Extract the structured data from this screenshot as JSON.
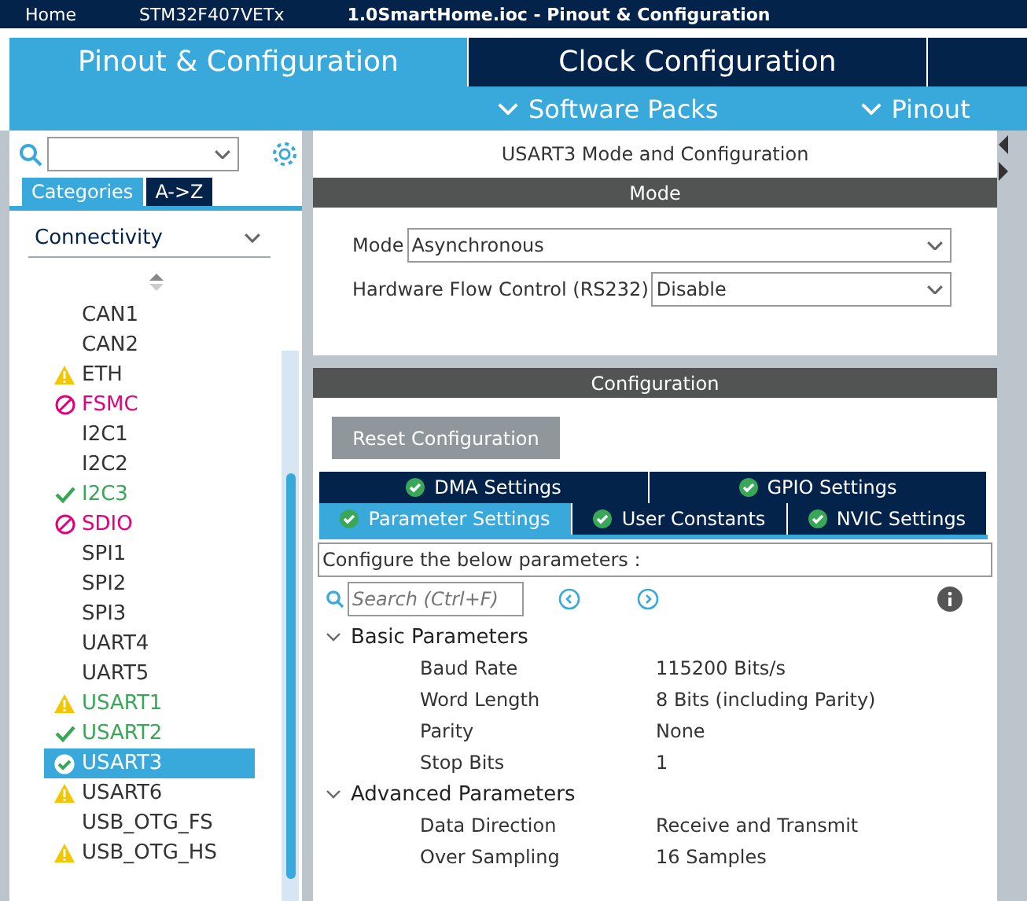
{
  "breadcrumbs": [
    "Home",
    "STM32F407VETx",
    "1.0SmartHome.ioc - Pinout & Configuration"
  ],
  "main_tabs": [
    {
      "label": "Pinout & Configuration",
      "selected": true
    },
    {
      "label": "Clock Configuration",
      "selected": false
    }
  ],
  "sub_menu": [
    "Software Packs",
    "Pinout"
  ],
  "sidebar": {
    "view_tabs": [
      {
        "label": "Categories",
        "selected": true
      },
      {
        "label": "A->Z",
        "selected": false
      }
    ],
    "category": "Connectivity",
    "items": [
      {
        "label": "CAN1",
        "kind": "plain",
        "selected": false
      },
      {
        "label": "CAN2",
        "kind": "plain",
        "selected": false
      },
      {
        "label": "ETH",
        "kind": "warning",
        "selected": false
      },
      {
        "label": "FSMC",
        "kind": "blocked",
        "selected": false
      },
      {
        "label": "I2C1",
        "kind": "plain",
        "selected": false
      },
      {
        "label": "I2C2",
        "kind": "plain",
        "selected": false
      },
      {
        "label": "I2C3",
        "kind": "configured",
        "selected": false
      },
      {
        "label": "SDIO",
        "kind": "blocked",
        "selected": false
      },
      {
        "label": "SPI1",
        "kind": "plain",
        "selected": false
      },
      {
        "label": "SPI2",
        "kind": "plain",
        "selected": false
      },
      {
        "label": "SPI3",
        "kind": "plain",
        "selected": false
      },
      {
        "label": "UART4",
        "kind": "plain",
        "selected": false
      },
      {
        "label": "UART5",
        "kind": "plain",
        "selected": false
      },
      {
        "label": "USART1",
        "kind": "partial",
        "selected": false
      },
      {
        "label": "USART2",
        "kind": "configured",
        "selected": false
      },
      {
        "label": "USART3",
        "kind": "configured",
        "selected": true
      },
      {
        "label": "USART6",
        "kind": "warning",
        "selected": false
      },
      {
        "label": "USB_OTG_FS",
        "kind": "plain",
        "selected": false
      },
      {
        "label": "USB_OTG_HS",
        "kind": "warning",
        "selected": false
      }
    ]
  },
  "panel": {
    "title": "USART3 Mode and Configuration",
    "mode_header": "Mode",
    "mode_fields": [
      {
        "label": "Mode",
        "value": "Asynchronous"
      },
      {
        "label": "Hardware Flow Control (RS232)",
        "value": "Disable"
      }
    ],
    "config_header": "Configuration",
    "reset_button": "Reset Configuration",
    "tabs_top": [
      {
        "label": "DMA Settings",
        "selected": false
      },
      {
        "label": "GPIO Settings",
        "selected": false
      }
    ],
    "tabs_bottom": [
      {
        "label": "Parameter Settings",
        "selected": true
      },
      {
        "label": "User Constants",
        "selected": false
      },
      {
        "label": "NVIC Settings",
        "selected": false
      }
    ],
    "hint": "Configure the below parameters :",
    "search": {
      "placeholder": "Search (Ctrl+F)"
    },
    "groups": [
      {
        "name": "Basic Parameters",
        "expanded": true,
        "params": [
          {
            "name": "Baud Rate",
            "value": "115200 Bits/s"
          },
          {
            "name": "Word Length",
            "value": "8 Bits (including Parity)"
          },
          {
            "name": "Parity",
            "value": "None"
          },
          {
            "name": "Stop Bits",
            "value": "1"
          }
        ]
      },
      {
        "name": "Advanced Parameters",
        "expanded": true,
        "params": [
          {
            "name": "Data Direction",
            "value": "Receive and Transmit"
          },
          {
            "name": "Over Sampling",
            "value": "16 Samples"
          }
        ]
      }
    ]
  }
}
